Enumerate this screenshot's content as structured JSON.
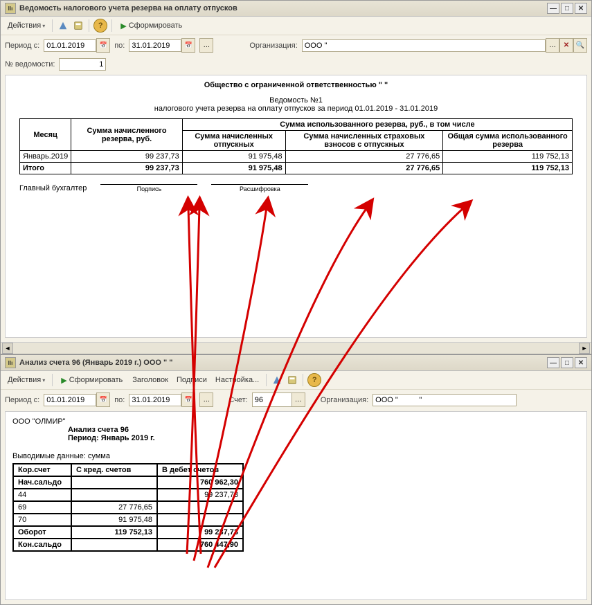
{
  "window1": {
    "title": "Ведомость налогового учета резерва на оплату отпусков",
    "menu": {
      "actions": "Действия"
    },
    "form_btn": "Сформировать",
    "period_from_lbl": "Период с:",
    "period_to_lbl": "по:",
    "date_from": "01.01.2019",
    "date_to": "31.01.2019",
    "org_lbl": "Организация:",
    "org_value": "ООО \"",
    "num_lbl": "№ ведомости:",
    "num_value": "1",
    "report": {
      "org_header": "Общество с ограниченной ответственностью \"          \"",
      "subtitle": "Ведомость №1",
      "period_line": "налогового учета резерва на оплату отпусков за период 01.01.2019 - 31.01.2019",
      "h_month": "Месяц",
      "h_accrued": "Сумма начисленного резерва, руб.",
      "h_used_group": "Сумма использованного резерва, руб., в том числе",
      "h_vac": "Сумма начисленных отпускных",
      "h_ins": "Сумма начисленных страховых взносов с отпускных",
      "h_total_used": "Общая сумма использованного резерва",
      "row_month": "Январь.2019",
      "row_accrued": "99 237,73",
      "row_vac": "91 975,48",
      "row_ins": "27 776,65",
      "row_total": "119 752,13",
      "itogo": "Итого",
      "t_accrued": "99 237,73",
      "t_vac": "91 975,48",
      "t_ins": "27 776,65",
      "t_total": "119 752,13",
      "chief_acc": "Главный бухгалтер",
      "sign": "Подпись",
      "decode": "Расшифровка"
    }
  },
  "window2": {
    "title": "Анализ счета 96 (Январь 2019 г.) ООО \"         \"",
    "menu": {
      "actions": "Действия"
    },
    "form_btn": "Сформировать",
    "header_btn": "Заголовок",
    "subacc_btn": "Подписи",
    "settings_btn": "Настройка...",
    "period_from_lbl": "Период с:",
    "period_to_lbl": "по:",
    "date_from": "01.01.2019",
    "date_to": "31.01.2019",
    "account_lbl": "Счет:",
    "account_value": "96",
    "org_lbl": "Организация:",
    "org_value": "ООО \"          \"",
    "report": {
      "org": "ООО \"ОЛМИР\"",
      "title": "Анализ счета 96",
      "period": "Период: Январь 2019 г.",
      "output_lbl": "Выводимые данные: сумма",
      "h_corr": "Кор.счет",
      "h_kred": "С кред. счетов",
      "h_deb": "В дебет счетов",
      "r_beg": "Нач.сальдо",
      "beg_deb": "760 962,30",
      "r_44": "44",
      "v_44_deb": "99 237,73",
      "r_69": "69",
      "v_69_kred": "27 776,65",
      "r_70": "70",
      "v_70_kred": "91 975,48",
      "r_turn": "Оборот",
      "turn_kred": "119 752,13",
      "turn_deb": "99 237,73",
      "r_end": "Кон.сальдо",
      "end_deb": "760 447,90"
    }
  }
}
